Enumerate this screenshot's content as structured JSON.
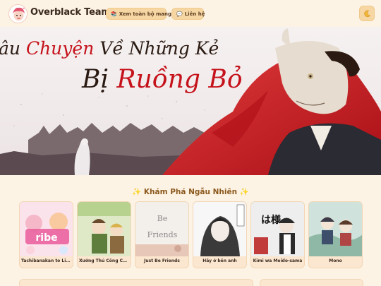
{
  "header": {
    "brand": "Overblack Team",
    "nav": [
      {
        "icon": "books-icon",
        "label": "Xem toàn bộ manga"
      },
      {
        "icon": "speech-bubble-icon",
        "label": "Liên hệ"
      }
    ],
    "theme_icon": "moon-icon"
  },
  "hero": {
    "title_line1_a": "âu ",
    "title_line1_b": "Chuyện",
    "title_line1_c": " Về Những Kẻ",
    "title_line2_a": "Bị ",
    "title_line2_b": "Ruồng Bỏ"
  },
  "random_section": {
    "title": "✨ Khám Phá Ngẫu Nhiên ✨",
    "cards": [
      {
        "title": "Tachibanakan to Lie ...",
        "cover_text": "ribe"
      },
      {
        "title": "Xưởng Thủ Công Của...",
        "cover_text": ""
      },
      {
        "title": "Just Be Friends",
        "cover_text_1": "Be",
        "cover_text_2": "Friends"
      },
      {
        "title": "Hãy ở bên anh",
        "cover_text": ""
      },
      {
        "title": "Kimi wa Meido-sama",
        "cover_text": "は様"
      },
      {
        "title": "Mono",
        "cover_text": ""
      }
    ]
  },
  "colors": {
    "background": "#fdf3e4",
    "pill": "#f6d7a3",
    "accent_red": "#c5121b",
    "section_title": "#8c5a1f"
  }
}
